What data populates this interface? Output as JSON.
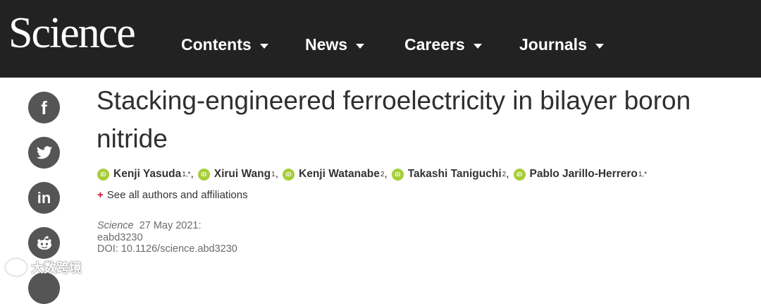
{
  "header": {
    "logo": "Science",
    "nav": [
      {
        "label": "Contents"
      },
      {
        "label": "News"
      },
      {
        "label": "Careers"
      },
      {
        "label": "Journals"
      }
    ]
  },
  "share": {
    "icons": [
      {
        "name": "facebook-icon",
        "glyph": "f"
      },
      {
        "name": "twitter-icon",
        "glyph": "🐦"
      },
      {
        "name": "linkedin-icon",
        "glyph": "in"
      },
      {
        "name": "reddit-icon",
        "glyph": "👽"
      },
      {
        "name": "email-icon",
        "glyph": ""
      }
    ]
  },
  "article": {
    "title": "Stacking-engineered ferroelectricity in bilayer boron nitride",
    "orcid_badge": "iD",
    "authors": [
      {
        "name": "Kenji Yasuda",
        "affil": "1,*"
      },
      {
        "name": "Xirui Wang",
        "affil": "1"
      },
      {
        "name": "Kenji Watanabe",
        "affil": "2"
      },
      {
        "name": "Takashi Taniguchi",
        "affil": "2"
      },
      {
        "name": "Pablo Jarillo-Herrero",
        "affil": "1,*"
      }
    ],
    "see_all": "See all authors and affiliations",
    "see_all_prefix": "+",
    "journal": "Science",
    "date": "27 May 2021:",
    "article_id": "eabd3230",
    "doi": "DOI: 10.1126/science.abd3230"
  },
  "watermark": {
    "text": "大数跨境"
  },
  "colors": {
    "header_bg": "#222222",
    "orcid": "#a6ce39",
    "plus": "#c8102e",
    "icon_bg": "#555555"
  }
}
